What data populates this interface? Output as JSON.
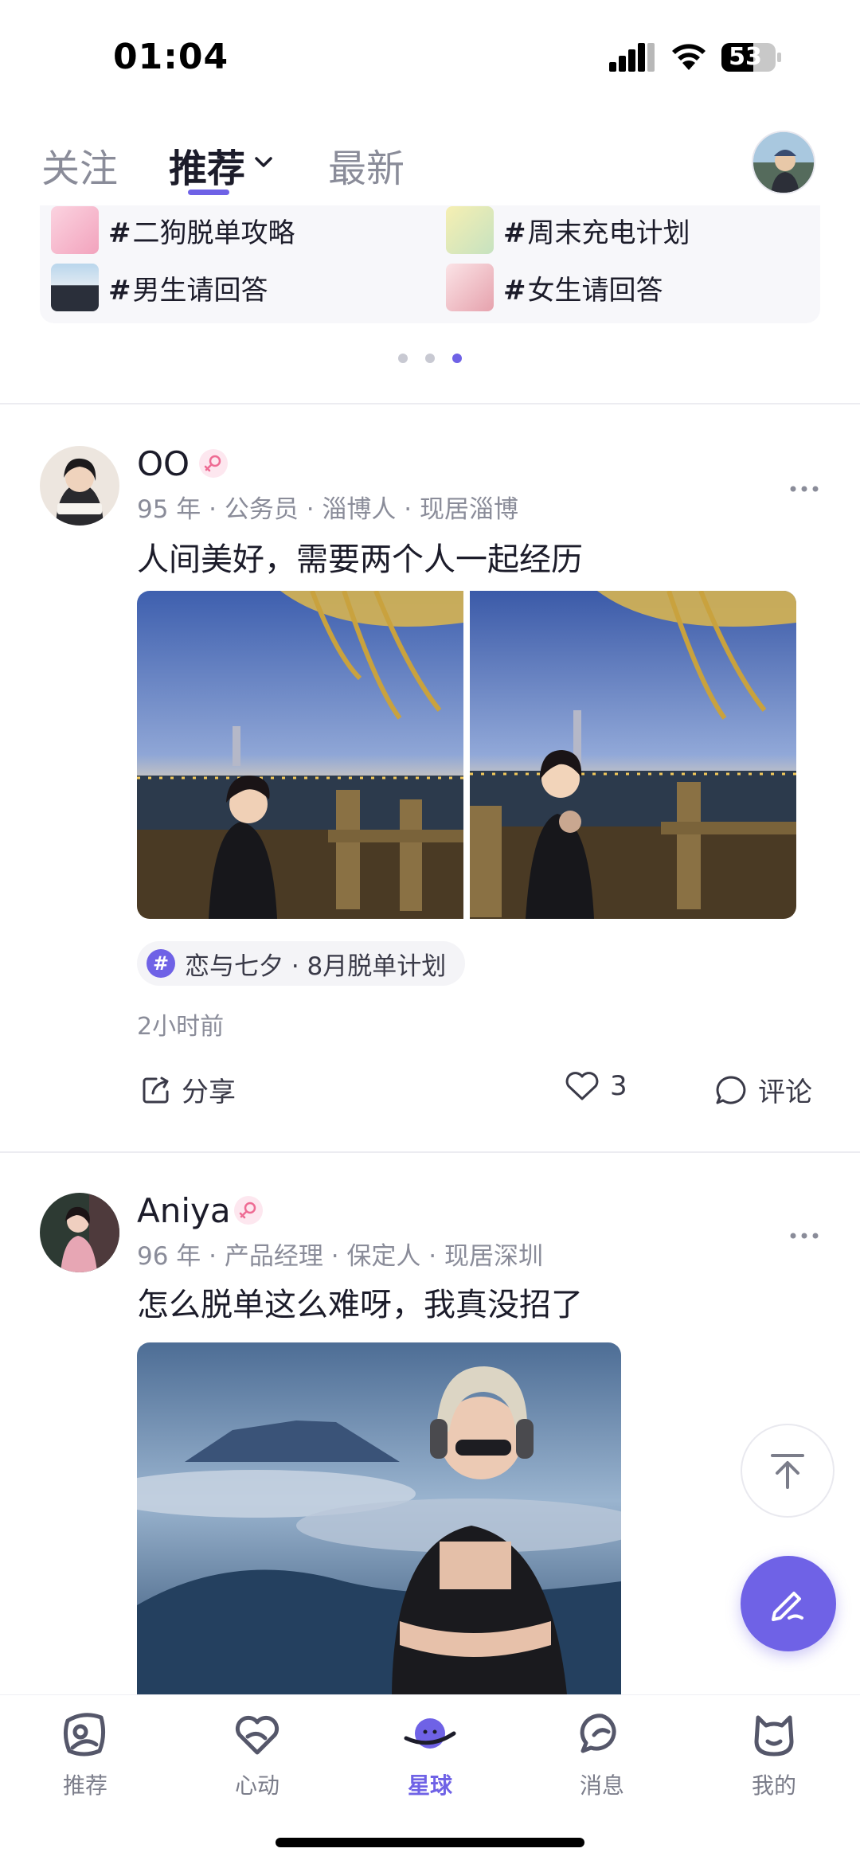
{
  "status_bar": {
    "time": "01:04",
    "battery": "53"
  },
  "tabs": {
    "follow": "关注",
    "recommend": "推荐",
    "latest": "最新"
  },
  "topics": [
    {
      "label": "二狗脱单攻略"
    },
    {
      "label": "周末充电计划"
    },
    {
      "label": "男生请回答"
    },
    {
      "label": "女生请回答"
    }
  ],
  "topic_hash": "#",
  "carousel": {
    "page_count": 3,
    "active_index": 2
  },
  "posts": [
    {
      "name": "OO",
      "meta": "95 年 · 公务员 · 淄博人 · 现居淄博",
      "text": "人间美好，需要两个人一起经历",
      "topic": "恋与七夕 · 8月脱单计划",
      "time": "2小时前",
      "share_label": "分享",
      "like_count": "3",
      "comment_label": "评论"
    },
    {
      "name": "Aniya",
      "meta": "96 年 · 产品经理 · 保定人 · 现居深圳",
      "text": "怎么脱单这么难呀，我真没招了"
    }
  ],
  "nav": [
    {
      "label": "推荐",
      "icon": "recommend-icon"
    },
    {
      "label": "心动",
      "icon": "heart-icon"
    },
    {
      "label": "星球",
      "icon": "planet-icon",
      "active": true
    },
    {
      "label": "消息",
      "icon": "message-icon"
    },
    {
      "label": "我的",
      "icon": "profile-icon"
    }
  ],
  "colors": {
    "accent": "#6f62e6",
    "text": "#1c1c2a",
    "secondary": "#8a8c99"
  }
}
